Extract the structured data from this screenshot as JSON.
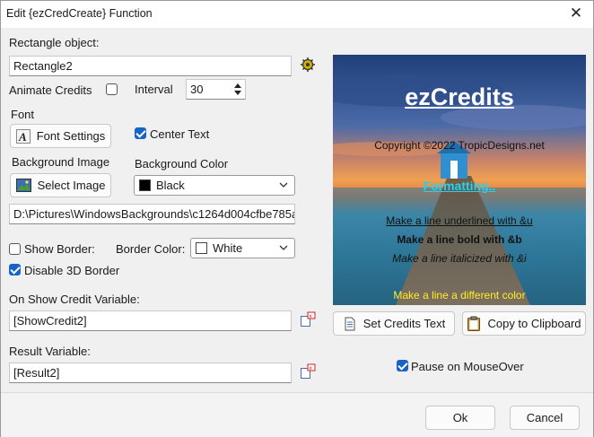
{
  "window": {
    "title": "Edit {ezCredCreate} Function"
  },
  "rectangle": {
    "label": "Rectangle object:",
    "value": "Rectangle2"
  },
  "animate": {
    "label": "Animate Credits",
    "checked": false
  },
  "interval": {
    "label": "Interval",
    "value": "30"
  },
  "font": {
    "label": "Font",
    "button": "Font Settings"
  },
  "center_text": {
    "label": "Center Text",
    "checked": true
  },
  "background_image": {
    "label": "Background Image",
    "button": "Select Image",
    "path": "D:\\Pictures\\WindowsBackgrounds\\c1264d004cfbe785a"
  },
  "background_color": {
    "label": "Background Color",
    "value": "Black",
    "swatch": "#000000"
  },
  "show_border": {
    "label": "Show Border:",
    "checked": false
  },
  "border_color": {
    "label": "Border Color:",
    "value": "White",
    "swatch": "#ffffff"
  },
  "disable_3d": {
    "label": "Disable 3D Border",
    "checked": true
  },
  "show_credit_var": {
    "label": "On Show Credit Variable:",
    "value": "[ShowCredit2]"
  },
  "result_var": {
    "label": "Result Variable:",
    "value": "[Result2]"
  },
  "preview": {
    "title": "ezCredits",
    "copyright": "Copyright ©2022 TropicDesigns.net",
    "formatting": "Formatting..",
    "underline_line": "Make a line underlined with &u",
    "bold_line": "Make a line bold with &b",
    "italic_line": "Make a line italicized with &i",
    "color_line": "Make a line a different color",
    "colors": {
      "title": "#ffffff",
      "formatting": "#22d3f5",
      "color_line": "#ffee22"
    }
  },
  "actions": {
    "set_credits": "Set Credits Text",
    "copy_clipboard": "Copy to Clipboard",
    "pause": {
      "label": "Pause on MouseOver",
      "checked": true
    },
    "ok": "Ok",
    "cancel": "Cancel"
  },
  "accent": "#1a63c6"
}
